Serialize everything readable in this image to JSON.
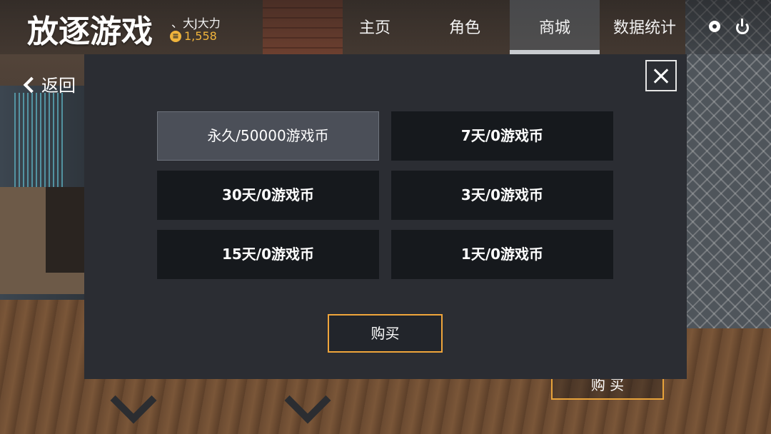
{
  "header": {
    "logo": "放逐游戏",
    "username": "、大J大力",
    "coins": "1,558",
    "coin_icon_glyph": "≡"
  },
  "tabs": [
    {
      "label": "主页",
      "active": false
    },
    {
      "label": "角色",
      "active": false
    },
    {
      "label": "商城",
      "active": true
    },
    {
      "label": "数据统计",
      "active": false
    }
  ],
  "icons": [
    "settings-gear-icon",
    "power-icon",
    "close-icon",
    "back-chevron-icon"
  ],
  "back_label": "返回",
  "modal": {
    "options": [
      {
        "label": "永久/50000游戏币",
        "selected": true
      },
      {
        "label": "7天/0游戏币",
        "selected": false
      },
      {
        "label": "30天/0游戏币",
        "selected": false
      },
      {
        "label": "3天/0游戏币",
        "selected": false
      },
      {
        "label": "15天/0游戏币",
        "selected": false
      },
      {
        "label": "1天/0游戏币",
        "selected": false
      }
    ],
    "buy_label": "购买"
  },
  "background_buy_label": "购 买",
  "colors": {
    "accent_orange": "#f0a53b",
    "coin_gold": "#f0b43c",
    "modal_bg": "#2b2d33",
    "option_bg": "#16191d",
    "option_selected_bg": "#4b4f58"
  }
}
